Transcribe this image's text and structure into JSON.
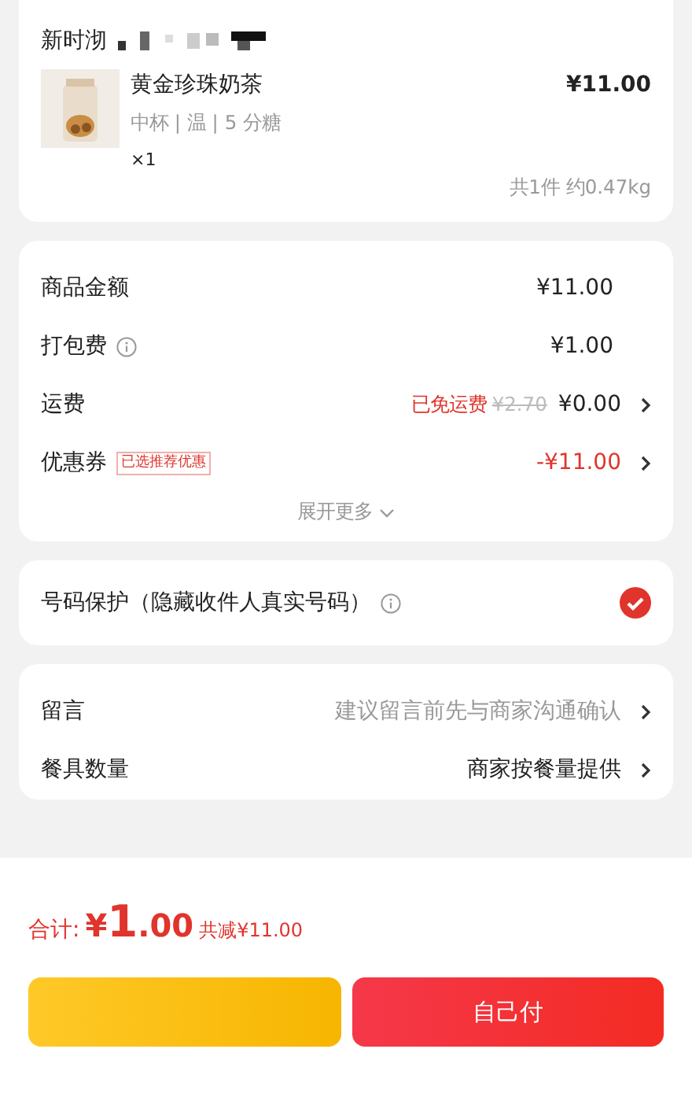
{
  "store": {
    "name": "新时沏"
  },
  "items": [
    {
      "name": "黄金珍珠奶茶",
      "specs": "中杯 | 温 | 5 分糖",
      "quantity": "×1",
      "price": "¥11.00"
    }
  ],
  "summary": "共1件 约0.47kg",
  "fees": [
    {
      "kind": "plain",
      "label": "商品金额",
      "value": "¥11.00"
    },
    {
      "kind": "info",
      "label": "打包费",
      "value": "¥1.00"
    },
    {
      "kind": "shipping",
      "label": "运费",
      "note": "已免运费",
      "original": "¥2.70",
      "value": "¥0.00"
    },
    {
      "kind": "coupon",
      "label": "优惠券",
      "tag": "已选推荐优惠",
      "value": "-¥11.00"
    }
  ],
  "expand": "展开更多",
  "privacy": {
    "label": "号码保护（隐藏收件人真实号码）",
    "checked": true
  },
  "options": [
    {
      "label": "留言",
      "value": "建议留言前先与商家沟通确认",
      "muted": true
    },
    {
      "label": "餐具数量",
      "value": "商家按餐量提供",
      "muted": false
    }
  ],
  "total": {
    "label": "合计:",
    "currency": "¥",
    "integer": "1",
    "decimal": ".00",
    "saved": "共减¥11.00"
  },
  "buttons": [
    {
      "kind": "yellow"
    },
    {
      "kind": "red",
      "label": "自己付"
    }
  ]
}
